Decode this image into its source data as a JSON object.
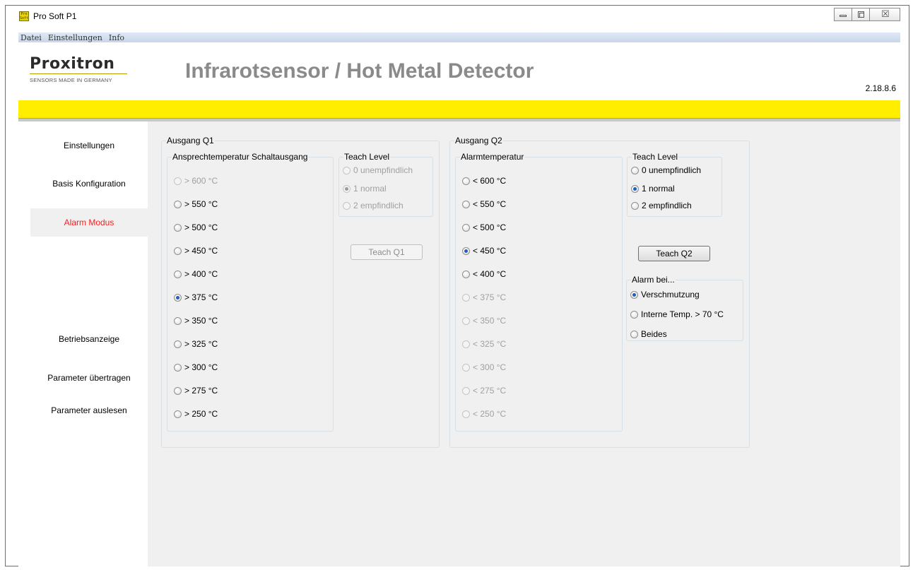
{
  "window": {
    "title": "Pro Soft P1",
    "icon_text": "Pro Soft",
    "controls": [
      "minimize-icon",
      "maximize-icon",
      "close-icon"
    ],
    "close_glyph": "☒"
  },
  "menu": {
    "items": [
      "Datei",
      "Einstellungen",
      "Info"
    ]
  },
  "header": {
    "logo_word": "Proxitron",
    "logo_tagline": "SENSORS MADE IN GERMANY",
    "title": "Infrarotsensor / Hot Metal Detector",
    "version": "2.18.8.6"
  },
  "colors": {
    "accent_yellow": "#ffee00",
    "active_nav": "#ff1a1a",
    "content_bg": "#f0f0f0"
  },
  "sidebar": {
    "items": [
      {
        "label": "Einstellungen",
        "active": false
      },
      {
        "label": "Basis Konfiguration",
        "active": false
      },
      {
        "label": "Alarm Modus",
        "active": true
      },
      {
        "label": "Betriebsanzeige",
        "active": false
      },
      {
        "label": "Parameter übertragen",
        "active": false
      },
      {
        "label": "Parameter auslesen",
        "active": false
      }
    ]
  },
  "q1": {
    "legend": "Ausgang Q1",
    "threshold_group": {
      "legend": "Ansprechtemperatur Schaltausgang",
      "options": [
        "> 600 °C",
        "> 550 °C",
        "> 500 °C",
        "> 450 °C",
        "> 400 °C",
        "> 375 °C",
        "> 350 °C",
        "> 325 °C",
        "> 300 °C",
        "> 275 °C",
        "> 250 °C"
      ],
      "selected": "> 375 °C"
    },
    "teach_group": {
      "legend": "Teach Level",
      "options": [
        "0 unempfindlich",
        "1 normal",
        "2 empfindlich"
      ],
      "selected": "1 normal"
    },
    "teach_button": "Teach Q1"
  },
  "q2": {
    "legend": "Ausgang Q2",
    "alarm_group": {
      "legend": "Alarmtemperatur",
      "options": [
        "< 600 °C",
        "< 550 °C",
        "< 500 °C",
        "< 450 °C",
        "< 400 °C",
        "< 375 °C",
        "< 350 °C",
        "< 325 °C",
        "< 300 °C",
        "< 275 °C",
        "< 250 °C"
      ],
      "selected": "< 450 °C"
    },
    "teach_group": {
      "legend": "Teach Level",
      "options": [
        "0 unempfindlich",
        "1 normal",
        "2 empfindlich"
      ],
      "selected": "1 normal"
    },
    "teach_button": "Teach Q2",
    "alarm_bei_group": {
      "legend": "Alarm bei...",
      "options": [
        "Verschmutzung",
        "Interne Temp. > 70 °C",
        "Beides"
      ],
      "selected": "Verschmutzung"
    }
  }
}
